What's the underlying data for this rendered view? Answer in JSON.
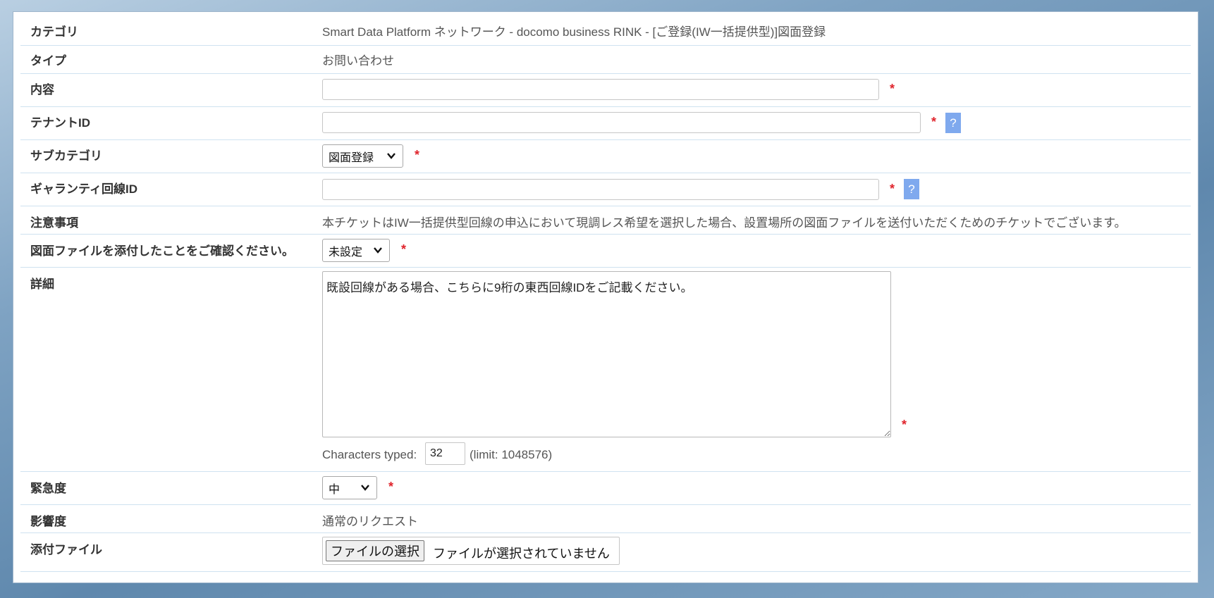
{
  "form": {
    "category": {
      "label": "カテゴリ",
      "value": "Smart Data Platform ネットワーク - docomo business RINK - [ご登録(IW一括提供型)]図面登録"
    },
    "type": {
      "label": "タイプ",
      "value": "お問い合わせ"
    },
    "content": {
      "label": "内容",
      "value": ""
    },
    "tenant_id": {
      "label": "テナントID",
      "value": "",
      "help": "?"
    },
    "subcategory": {
      "label": "サブカテゴリ",
      "selected": "図面登録"
    },
    "guarantee_line_id": {
      "label": "ギャランティ回線ID",
      "value": "",
      "help": "?"
    },
    "notice": {
      "label": "注意事項",
      "value": "本チケットはIW一括提供型回線の申込において現調レス希望を選択した場合、設置場所の図面ファイルを送付いただくためのチケットでございます。"
    },
    "confirm_attach": {
      "label": "図面ファイルを添付したことをご確認ください。",
      "selected": "未設定"
    },
    "details": {
      "label": "詳細",
      "value": "既設回線がある場合、こちらに9桁の東西回線IDをご記載ください。",
      "chars_typed_label": "Characters typed:",
      "chars_typed": "32",
      "limit_text": "(limit: 1048576)"
    },
    "urgency": {
      "label": "緊急度",
      "selected": "中"
    },
    "impact": {
      "label": "影響度",
      "value": "通常のリクエスト"
    },
    "attachment": {
      "label": "添付ファイル",
      "button": "ファイルの選択",
      "status": "ファイルが選択されていません"
    },
    "required_mark": "*"
  },
  "colors": {
    "required": "#e0242c",
    "help_bg": "#7fa9ee",
    "row_border": "#cfe2f0"
  }
}
